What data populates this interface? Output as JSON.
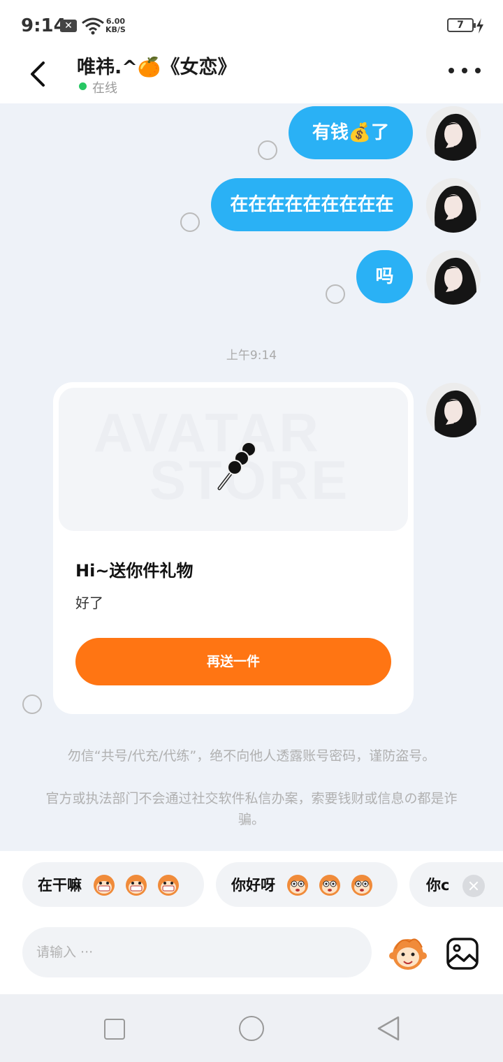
{
  "status_bar": {
    "time": "9:14",
    "net_speed_value": "6.00",
    "net_speed_unit": "KB/S",
    "battery": "7"
  },
  "header": {
    "title": "唯祎.^🍊《女恋》",
    "status": "在线"
  },
  "messages": [
    {
      "text": "有钱💰了"
    },
    {
      "text": "在在在在在在在在在"
    },
    {
      "text": "吗"
    }
  ],
  "timestamp": "上午9:14",
  "gift_card": {
    "watermark_line1": "AVATAR",
    "watermark_line2": "STORE",
    "title": "Hi~送你件礼物",
    "subtitle": "好了",
    "button_label": "再送一件"
  },
  "warnings": [
    "勿信“共号/代充/代练”，绝不向他人透露账号密码，谨防盗号。",
    "官方或执法部门不会通过社交软件私信办案，索要钱财或信息の都是诈骗。"
  ],
  "quick_replies": [
    {
      "label": "在干嘛"
    },
    {
      "label": "你好呀"
    },
    {
      "label": "你c"
    }
  ],
  "input": {
    "placeholder": "请输入 ···"
  },
  "colors": {
    "bubble": "#2ab1f5",
    "accent": "#ff7513",
    "online": "#27c763"
  }
}
